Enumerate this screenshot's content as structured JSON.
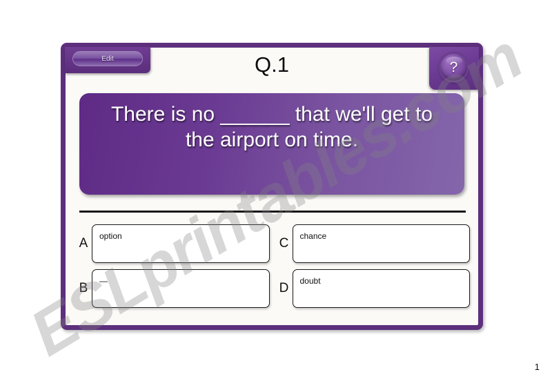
{
  "page": {
    "background_color": "#ffffff",
    "page_number": "1",
    "watermark": "ESLprintables.com"
  },
  "frame": {
    "border_color": "#5d2f7d",
    "interior_color": "#fbfaf7"
  },
  "toolbar": {
    "edit_label": "Edit",
    "help_label": "?",
    "help_icon": "question-mark-icon"
  },
  "header": {
    "title": "Q.1"
  },
  "question": {
    "text": "There is no ______ that we'll get to\nthe airport on time.",
    "gradient_from": "#5e2a85",
    "gradient_to": "#8466ab",
    "text_color": "#ffffff"
  },
  "answers": [
    {
      "letter": "A",
      "value": "option"
    },
    {
      "letter": "C",
      "value": "chance"
    },
    {
      "letter": "B",
      "value": "—"
    },
    {
      "letter": "D",
      "value": "doubt"
    }
  ]
}
